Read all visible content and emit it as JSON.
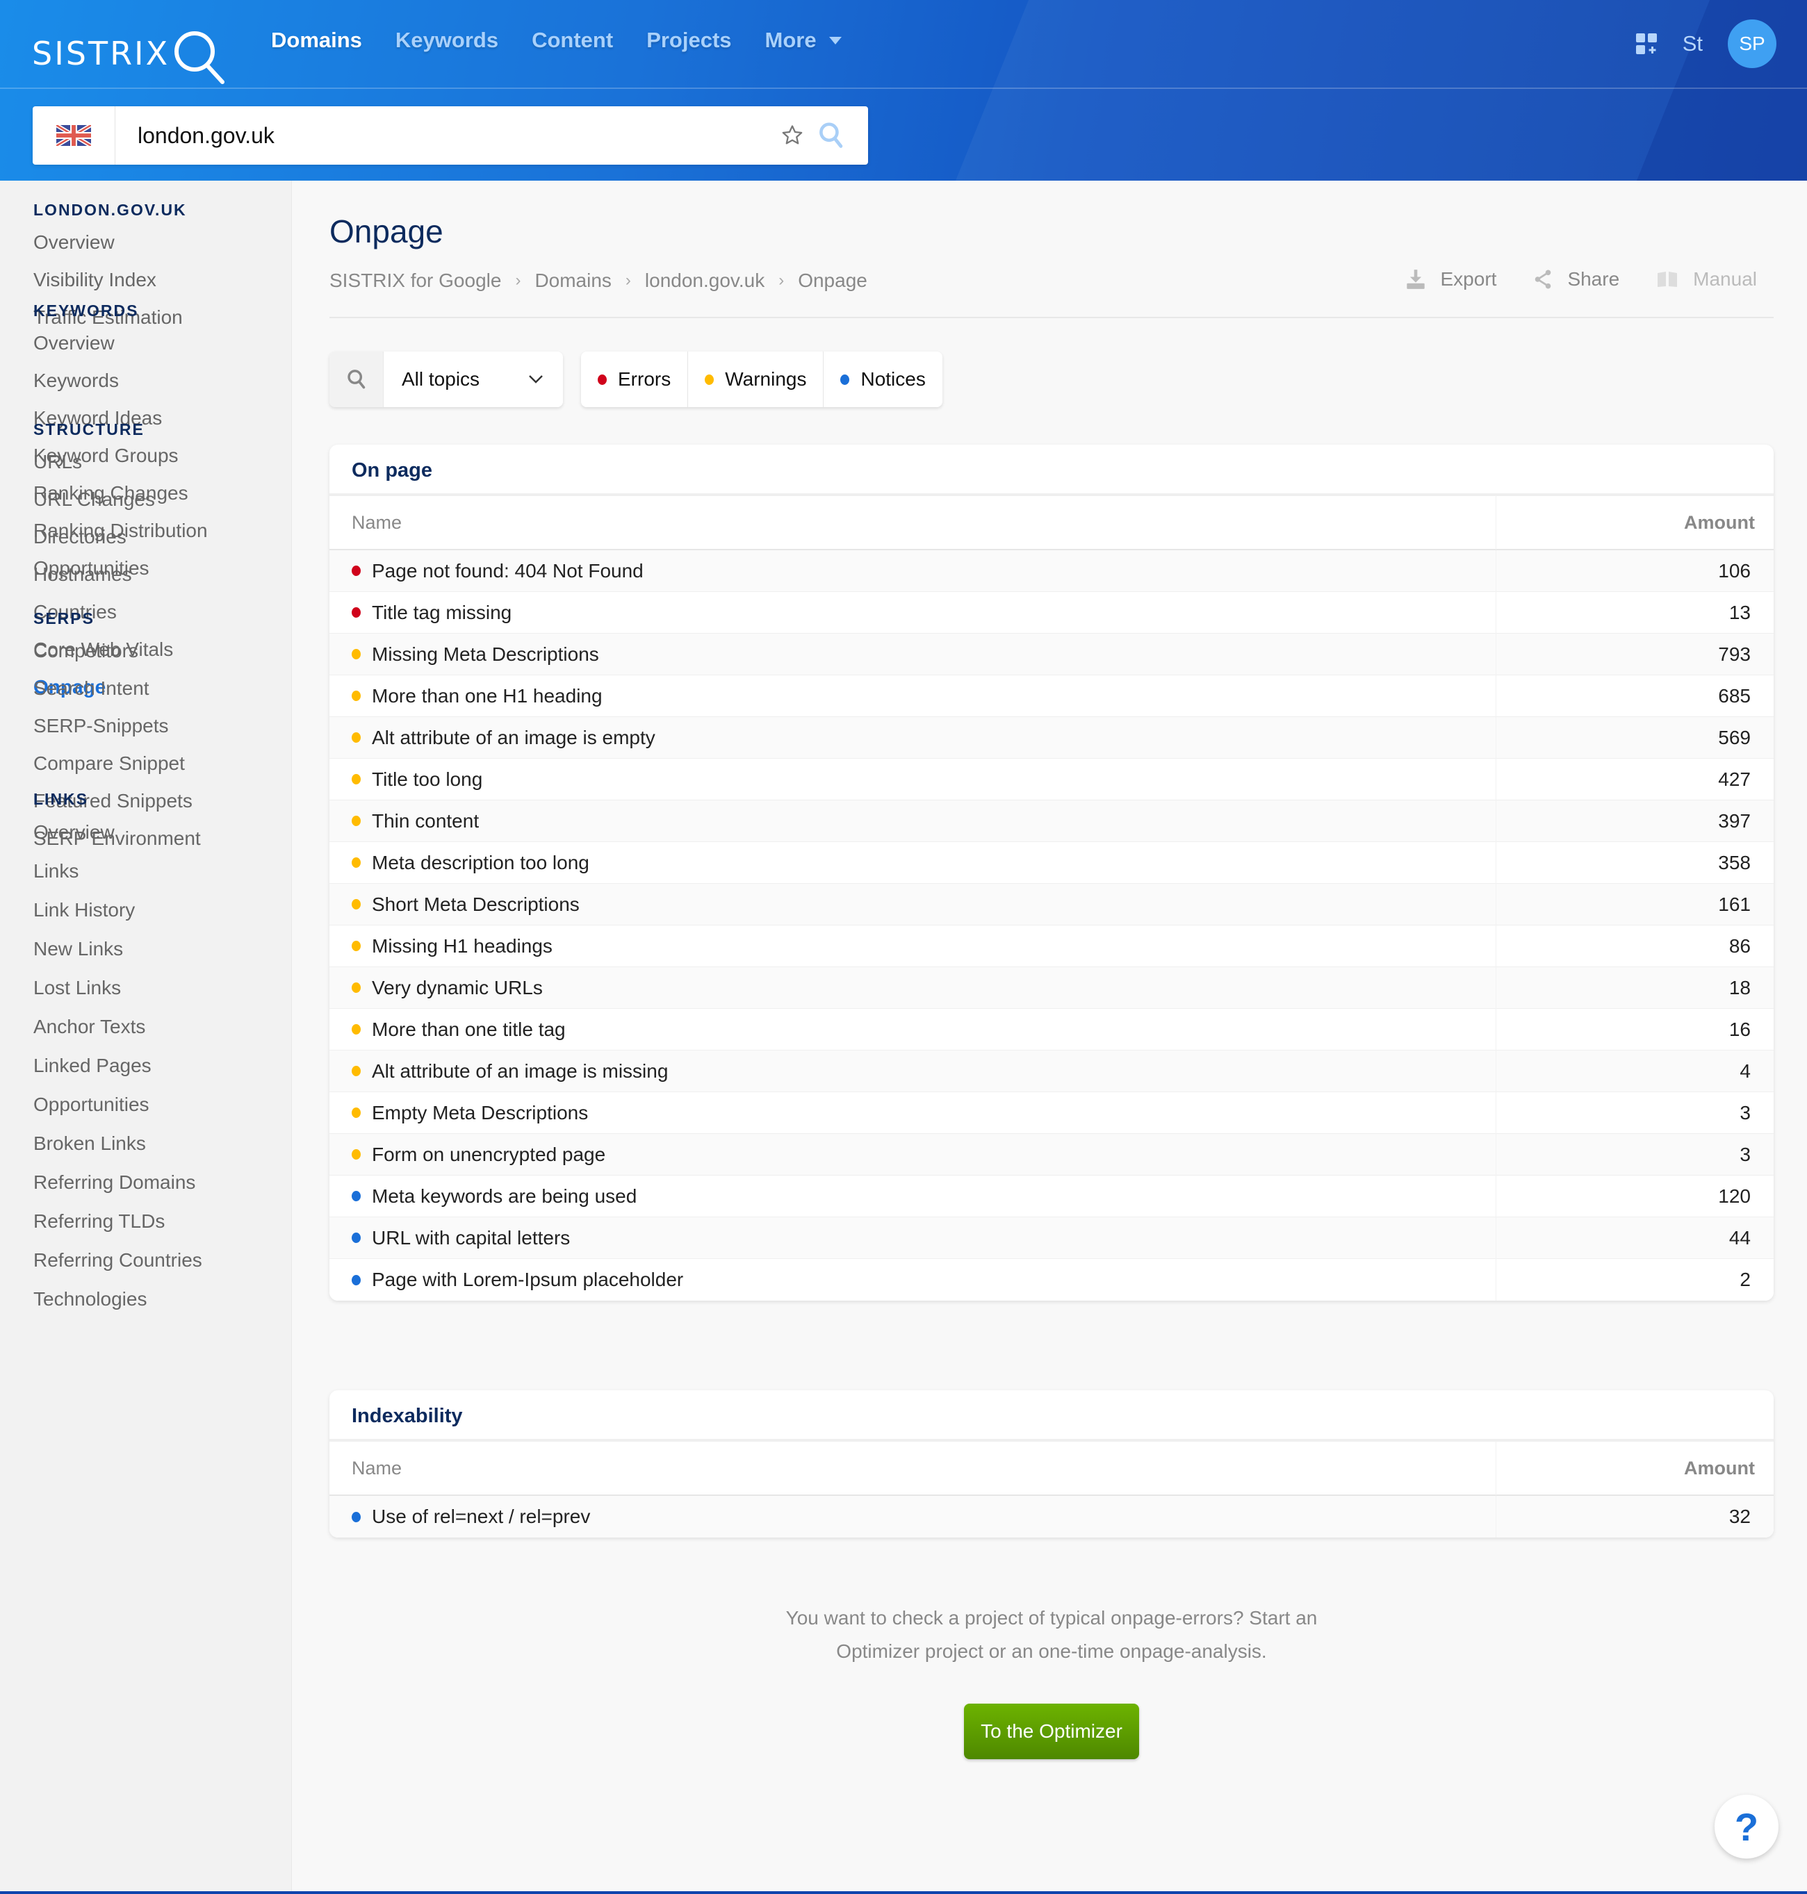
{
  "header": {
    "logo_text": "SISTRIX",
    "nav": [
      {
        "label": "Domains",
        "active": true
      },
      {
        "label": "Keywords",
        "active": false
      },
      {
        "label": "Content",
        "active": false
      },
      {
        "label": "Projects",
        "active": false
      },
      {
        "label": "More",
        "active": false,
        "has_dropdown": true
      }
    ],
    "user_short": "St",
    "avatar_initials": "SP",
    "icons": {
      "apps": "apps-grid-plus-icon",
      "search": "search-icon",
      "star": "star-icon",
      "flag": "uk-flag-icon"
    }
  },
  "search": {
    "country": "United Kingdom",
    "value": "london.gov.uk"
  },
  "sidebar": {
    "sections": [
      {
        "heading": "LONDON.GOV.UK",
        "items": [
          "Overview",
          "Visibility Index",
          "Traffic Estimation"
        ]
      },
      {
        "heading": "KEYWORDS",
        "items": [
          "Overview",
          "Keywords",
          "Keyword Ideas",
          "Keyword Groups",
          "Ranking Changes",
          "Ranking Distribution",
          "Opportunities"
        ]
      },
      {
        "heading": "STRUCTURE",
        "items": [
          "URLs",
          "URL Changes",
          "Directories",
          "Hostnames",
          "Countries",
          "Core Web Vitals",
          "Onpage"
        ]
      },
      {
        "heading": "SERPS",
        "items": [
          "Competitors",
          "Search Intent",
          "SERP-Snippets",
          "Compare Snippet",
          "Featured Snippets",
          "SERP Environment"
        ]
      },
      {
        "heading": "LINKS",
        "items": [
          "Overview",
          "Links",
          "Link History",
          "New Links",
          "Lost Links",
          "Anchor Texts",
          "Linked Pages",
          "Opportunities",
          "Broken Links",
          "Referring Domains",
          "Referring TLDs",
          "Referring Countries",
          "Technologies"
        ]
      }
    ],
    "active_item": "Onpage"
  },
  "page": {
    "title": "Onpage",
    "breadcrumb": [
      "SISTRIX for Google",
      "Domains",
      "london.gov.uk",
      "Onpage"
    ],
    "actions": {
      "export": "Export",
      "share": "Share",
      "manual": "Manual"
    }
  },
  "filters": {
    "topic": "All topics",
    "severity": [
      {
        "label": "Errors",
        "color": "#d0021b"
      },
      {
        "label": "Warnings",
        "color": "#ffbb00"
      },
      {
        "label": "Notices",
        "color": "#1a6fd8"
      }
    ]
  },
  "severity_colors": {
    "error": "#d0021b",
    "warning": "#ffbb00",
    "notice": "#1a6fd8"
  },
  "tables": {
    "onpage": {
      "title": "On page",
      "columns": {
        "name": "Name",
        "amount": "Amount"
      },
      "rows": [
        {
          "severity": "error",
          "name": "Page not found: 404 Not Found",
          "amount": "106"
        },
        {
          "severity": "error",
          "name": "Title tag missing",
          "amount": "13"
        },
        {
          "severity": "warning",
          "name": "Missing Meta Descriptions",
          "amount": "793"
        },
        {
          "severity": "warning",
          "name": "More than one H1 heading",
          "amount": "685"
        },
        {
          "severity": "warning",
          "name": "Alt attribute of an image is empty",
          "amount": "569"
        },
        {
          "severity": "warning",
          "name": "Title too long",
          "amount": "427"
        },
        {
          "severity": "warning",
          "name": "Thin content",
          "amount": "397"
        },
        {
          "severity": "warning",
          "name": "Meta description too long",
          "amount": "358"
        },
        {
          "severity": "warning",
          "name": "Short Meta Descriptions",
          "amount": "161"
        },
        {
          "severity": "warning",
          "name": "Missing H1 headings",
          "amount": "86"
        },
        {
          "severity": "warning",
          "name": "Very dynamic URLs",
          "amount": "18"
        },
        {
          "severity": "warning",
          "name": "More than one title tag",
          "amount": "16"
        },
        {
          "severity": "warning",
          "name": "Alt attribute of an image is missing",
          "amount": "4"
        },
        {
          "severity": "warning",
          "name": "Empty Meta Descriptions",
          "amount": "3"
        },
        {
          "severity": "warning",
          "name": "Form on unencrypted page",
          "amount": "3"
        },
        {
          "severity": "notice",
          "name": "Meta keywords are being used",
          "amount": "120"
        },
        {
          "severity": "notice",
          "name": "URL with capital letters",
          "amount": "44"
        },
        {
          "severity": "notice",
          "name": "Page with Lorem-Ipsum placeholder",
          "amount": "2"
        }
      ]
    },
    "indexability": {
      "title": "Indexability",
      "columns": {
        "name": "Name",
        "amount": "Amount"
      },
      "rows": [
        {
          "severity": "notice",
          "name": "Use of rel=next / rel=prev",
          "amount": "32"
        }
      ]
    }
  },
  "cta": {
    "text_line1": "You want to check a project of typical onpage-errors? Start an",
    "text_line2": "Optimizer project or an one-time onpage-analysis.",
    "button": "To the Optimizer",
    "button_color": "#5c9e00"
  },
  "help": {
    "label": "?"
  }
}
